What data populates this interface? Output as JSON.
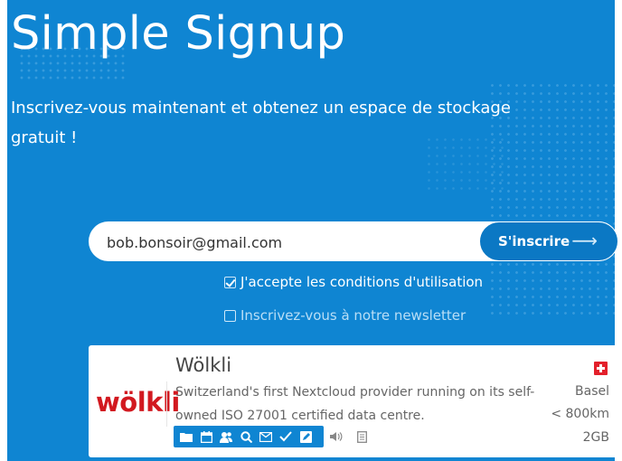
{
  "header": {
    "title": "Simple Signup",
    "subtitle": "Inscrivez-vous maintenant et obtenez un espace de stockage gratuit !"
  },
  "signup": {
    "email_value": "bob.bonsoir@gmail.com",
    "submit_label": "S'inscrire",
    "terms_label": "J'accepte les conditions d'utilisation",
    "terms_checked": true,
    "newsletter_label": "Inscrivez-vous à notre newsletter",
    "newsletter_checked": false
  },
  "provider": {
    "logo_text": "wölkli",
    "name": "Wölkli",
    "description": "Switzerland's first Nextcloud provider running on its self-owned ISO 27001 certified data centre.",
    "country_flag": "switzerland-flag-icon",
    "location": "Basel",
    "latency": "< 800km",
    "free_storage": "2GB",
    "features_enabled": [
      "folder-icon",
      "calendar-icon",
      "contacts-icon",
      "search-icon",
      "mail-icon",
      "check-icon",
      "notes-icon"
    ],
    "features_disabled": [
      "audio-icon",
      "document-icon"
    ]
  },
  "colors": {
    "background": "#0f85d2",
    "button": "#0b78c4",
    "logo": "#d21920",
    "flag": "#e3202b"
  }
}
